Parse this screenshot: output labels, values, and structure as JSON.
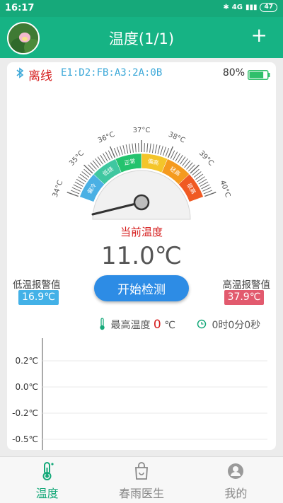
{
  "status_bar": {
    "time": "16:17",
    "network": "4G",
    "battery": "47"
  },
  "header": {
    "title": "温度(1/1)",
    "add_icon": "+"
  },
  "device": {
    "status": "离线",
    "mac": "E1:D2:FB:A3:2A:0B",
    "battery_percent": "80%",
    "battery_level": 0.8
  },
  "gauge": {
    "ticks": [
      "34°C",
      "35°C",
      "36°C",
      "37°C",
      "38°C",
      "39°C",
      "40°C"
    ],
    "zones": [
      {
        "label": "偏冷",
        "color": "#4ab0e4"
      },
      {
        "label": "低烧",
        "color": "#3fc7a0"
      },
      {
        "label": "正常",
        "color": "#24c36e"
      },
      {
        "label": "偏高",
        "color": "#f4c52a"
      },
      {
        "label": "轻高",
        "color": "#f59a1e"
      },
      {
        "label": "很高",
        "color": "#f05a23"
      }
    ],
    "caption": "当前温度",
    "value": "11.0℃"
  },
  "alarms": {
    "low_label": "低温报警值",
    "low_value": "16.9℃",
    "high_label": "高温报警值",
    "high_value": "37.9℃"
  },
  "start_button": "开始检测",
  "stats": {
    "max_label": "最高温度",
    "max_value": "0",
    "max_unit": "℃",
    "timer": "0时0分0秒"
  },
  "chart_data": {
    "type": "line",
    "y_ticks": [
      "0.2℃",
      "0.0℃",
      "-0.2℃",
      "-0.5℃"
    ],
    "series": []
  },
  "nav": [
    {
      "label": "温度",
      "icon": "thermometer-icon",
      "active": true
    },
    {
      "label": "春雨医生",
      "icon": "bag-icon",
      "active": false
    },
    {
      "label": "我的",
      "icon": "user-icon",
      "active": false
    }
  ],
  "colors": {
    "primary": "#16b384",
    "offline": "#d62020",
    "accent_blue": "#2d8ce5"
  }
}
